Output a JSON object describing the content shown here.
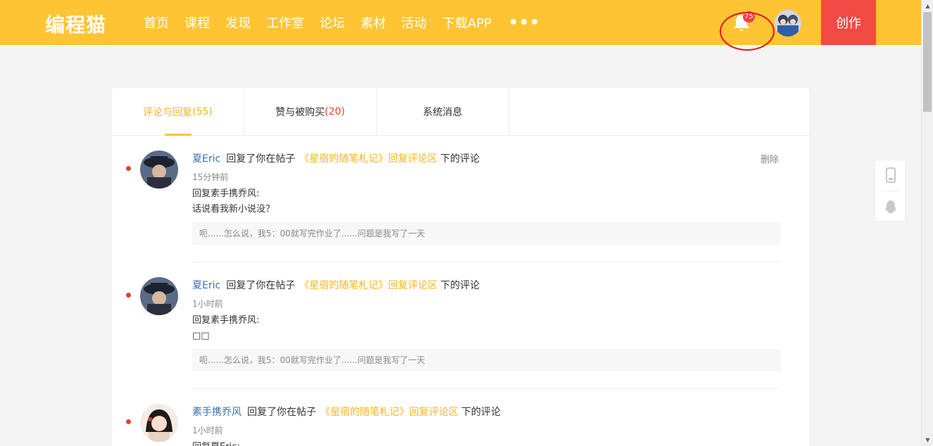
{
  "header": {
    "logo": "编程猫",
    "nav": [
      "首页",
      "课程",
      "发现",
      "工作室",
      "论坛",
      "素材",
      "活动",
      "下载APP"
    ],
    "more": "•••",
    "notification_count": "75",
    "create_label": "创作",
    "brand_color": "#fec433",
    "create_color": "#f14a43"
  },
  "tabs": [
    {
      "label": "评论与回复",
      "count": "(55)",
      "active": true
    },
    {
      "label": "赞与被购买",
      "count": "(20)",
      "active": false
    },
    {
      "label": "系统消息",
      "count": "",
      "active": false
    }
  ],
  "notifications": [
    {
      "user": "夏Eric",
      "action": "回复了你在帖子",
      "post": "《星宿的随笔札记》回复评论区",
      "tail": "下的评论",
      "time": "15分钟前",
      "reply_line1": "回复素手携乔风:",
      "reply_line2": "话说看我新小说没？",
      "quote": "呃......怎么说，我5：00就写完作业了......问题是我写了一天",
      "delete": "删除"
    },
    {
      "user": "夏Eric",
      "action": "回复了你在帖子",
      "post": "《星宿的随笔札记》回复评论区",
      "tail": "下的评论",
      "time": "1小时前",
      "reply_line1": "回复素手携乔风:",
      "reply_line2": "□□",
      "quote": "呃......怎么说，我5：00就写完作业了......问题是我写了一天"
    },
    {
      "user": "素手携乔风",
      "action": "回复了你在帖子",
      "post": "《星宿的随笔札记》回复评论区",
      "tail": "下的评论",
      "time": "1小时前",
      "reply_line1": "回复夏Eric:"
    }
  ]
}
